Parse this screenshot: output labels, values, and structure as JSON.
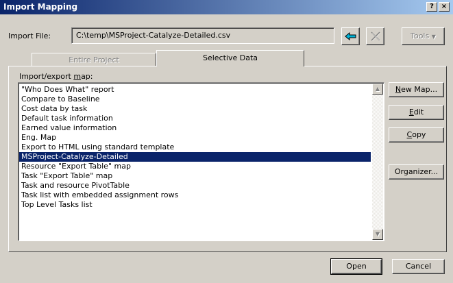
{
  "window": {
    "title": "Import Mapping",
    "help_glyph": "?",
    "close_glyph": "×"
  },
  "import_file": {
    "label": "Import File:",
    "value": "C:\\temp\\MSProject-Catalyze-Detailed.csv",
    "tools_label": "Tools"
  },
  "tabs": [
    {
      "label": "Entire Project",
      "active": false
    },
    {
      "label": "Selective Data",
      "active": true
    }
  ],
  "map_list": {
    "label": "Import/export map:",
    "items": [
      "\"Who Does What\" report",
      "Compare to Baseline",
      "Cost data by task",
      "Default task information",
      "Earned value information",
      "Eng. Map",
      "Export to HTML using standard template",
      "MSProject-Catalyze-Detailed",
      "Resource \"Export Table\" map",
      "Task \"Export Table\" map",
      "Task and resource PivotTable",
      "Task list with embedded assignment rows",
      "Top Level Tasks list"
    ],
    "selected_index": 7
  },
  "side_buttons": {
    "new_map": "New Map...",
    "edit": "Edit",
    "copy": "Copy",
    "organizer": "Organizer..."
  },
  "footer": {
    "open": "Open",
    "cancel": "Cancel"
  },
  "colors": {
    "selection": "#0a246a",
    "title_start": "#0a246a",
    "title_end": "#a6caf0",
    "face": "#d4d0c8"
  }
}
